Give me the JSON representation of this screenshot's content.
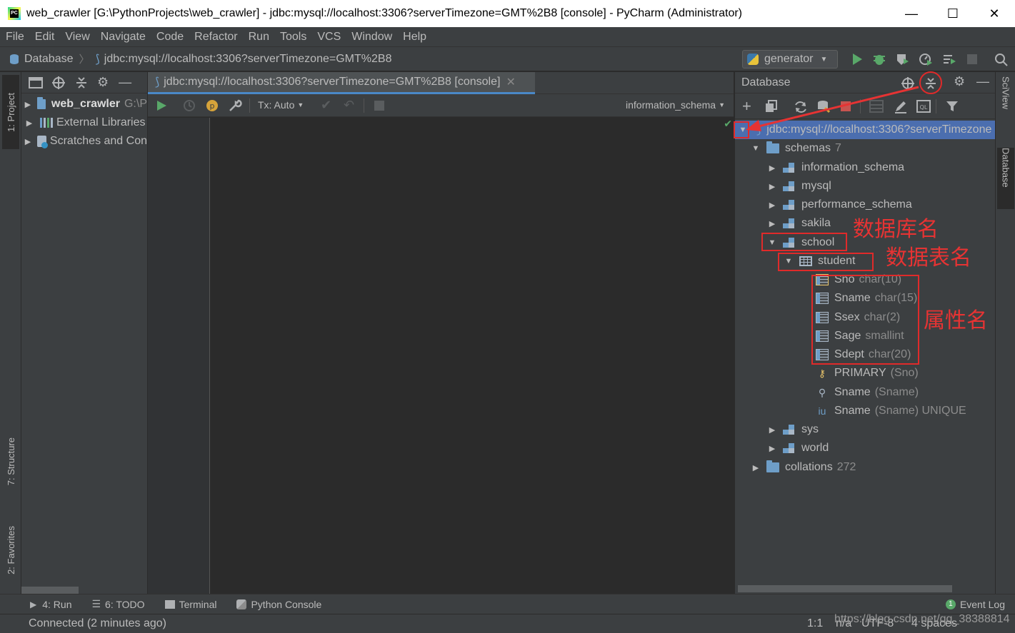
{
  "window": {
    "title": "web_crawler [G:\\PythonProjects\\web_crawler] - jdbc:mysql://localhost:3306?serverTimezone=GMT%2B8 [console] - PyCharm (Administrator)",
    "app_icon_text": "PC"
  },
  "menu": [
    "File",
    "Edit",
    "View",
    "Navigate",
    "Code",
    "Refactor",
    "Run",
    "Tools",
    "VCS",
    "Window",
    "Help"
  ],
  "breadcrumb": {
    "root": "Database",
    "item": "jdbc:mysql://localhost:3306?serverTimezone=GMT%2B8"
  },
  "run_config": "generator",
  "left_tool_tabs": {
    "project": "1: Project",
    "structure": "7: Structure",
    "favorites": "2: Favorites"
  },
  "project_tree": [
    {
      "label": "web_crawler",
      "suffix": "G:\\P"
    },
    {
      "label": "External Libraries"
    },
    {
      "label": "Scratches and Con"
    }
  ],
  "editor": {
    "tab": "jdbc:mysql://localhost:3306?serverTimezone=GMT%2B8 [console]",
    "tx_mode": "Tx: Auto",
    "schema": "information_schema"
  },
  "database_panel": {
    "title": "Database",
    "connection": "jdbc:mysql://localhost:3306?serverTimezone",
    "schemas_label": "schemas",
    "schemas_count": "7",
    "schemas": [
      "information_schema",
      "mysql",
      "performance_schema",
      "sakila",
      "school"
    ],
    "table": "student",
    "columns": [
      {
        "name": "Sno",
        "type": "char(10)"
      },
      {
        "name": "Sname",
        "type": "char(15)"
      },
      {
        "name": "Ssex",
        "type": "char(2)"
      },
      {
        "name": "Sage",
        "type": "smallint"
      },
      {
        "name": "Sdept",
        "type": "char(20)"
      }
    ],
    "keys": [
      {
        "name": "PRIMARY",
        "detail": "(Sno)"
      },
      {
        "name": "Sname",
        "detail": "(Sname)"
      },
      {
        "name": "Sname",
        "detail": "(Sname) UNIQUE"
      }
    ],
    "other_schemas": [
      "sys",
      "world"
    ],
    "collations_label": "collations",
    "collations_count": "272"
  },
  "right_tool_tabs": {
    "sciview": "SciView",
    "database": "Database"
  },
  "annotations": {
    "db_name": "数据库名",
    "table_name": "数据表名",
    "attr_name": "属性名"
  },
  "bottom_tabs": [
    {
      "label": "4: Run"
    },
    {
      "label": "6: TODO"
    },
    {
      "label": "Terminal"
    },
    {
      "label": "Python Console"
    }
  ],
  "event_log": "Event Log",
  "status": {
    "message": "Connected (2 minutes ago)",
    "position": "1:1",
    "line_sep": "n/a",
    "encoding": "UTF-8",
    "indent": "4 spaces",
    "watermark": "https://blog.csdn.net/qq_38388814"
  },
  "colors": {
    "selection": "#4b6eaf",
    "accent_blue": "#6e9ec8",
    "annotation_red": "#e63333",
    "run_green": "#59a869"
  }
}
